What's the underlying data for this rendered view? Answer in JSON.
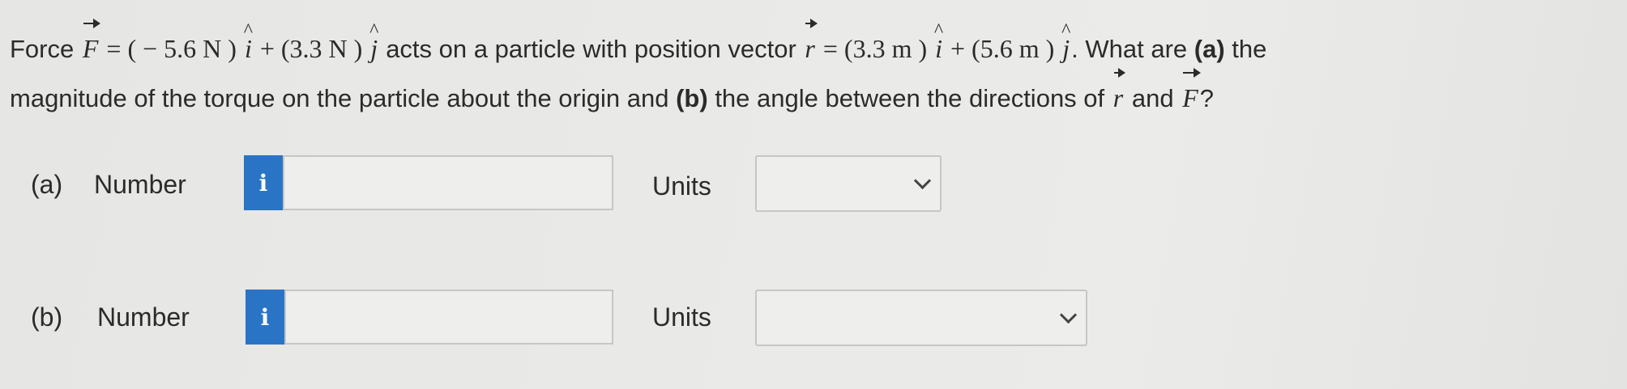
{
  "question": {
    "force_word": "Force",
    "F": "F",
    "eq": "= ( − 5.6 N )",
    "i_hat": "i",
    "plus1": "+ (3.3 N )",
    "j_hat": "j",
    "acts_text": "acts on a particle with position vector",
    "r": "r",
    "eq2": "= (3.3 m )",
    "plus2": "+ (5.6 m )",
    "after_j2": ". What are",
    "part_a_marker": "(a)",
    "the_text": "the",
    "line2_text": "magnitude of the torque on the particle about the origin and",
    "part_b_marker": "(b)",
    "line2_text2": "the angle between the directions of",
    "and_text": "and",
    "qmark": "?"
  },
  "part_a": {
    "label": "(a)",
    "number_label": "Number",
    "info_icon": "i",
    "answer_value": "",
    "units_label": "Units",
    "units_selected": ""
  },
  "part_b": {
    "label": "(b)",
    "number_label": "Number",
    "info_icon": "i",
    "answer_value": "",
    "units_label": "Units",
    "units_selected": ""
  },
  "colors": {
    "info_button": "#2a74c6",
    "background": "#e8e8e6",
    "text": "#2b2b2b"
  },
  "icons": {
    "info": "info-icon",
    "dropdown": "chevron-down-icon"
  }
}
